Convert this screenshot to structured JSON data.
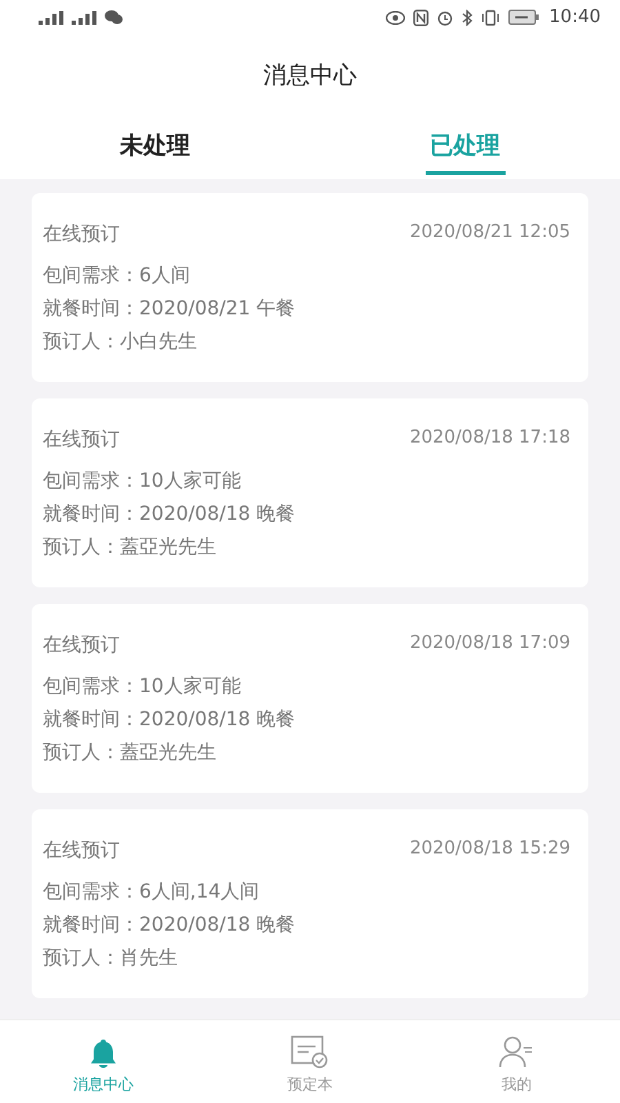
{
  "status_bar": {
    "time": "10:40"
  },
  "header": {
    "title": "消息中心"
  },
  "tabs": [
    {
      "label": "未处理",
      "selected": false
    },
    {
      "label": "已处理",
      "selected": true
    }
  ],
  "messages": [
    {
      "type": "在线预订",
      "time": "2020/08/21 12:05",
      "lines": [
        "包间需求：6人间",
        "就餐时间：2020/08/21 午餐",
        "预订人：小白先生"
      ]
    },
    {
      "type": "在线预订",
      "time": "2020/08/18 17:18",
      "lines": [
        "包间需求：10人家可能",
        "就餐时间：2020/08/18 晚餐",
        "预订人：蓋亞光先生"
      ]
    },
    {
      "type": "在线预订",
      "time": "2020/08/18 17:09",
      "lines": [
        "包间需求：10人家可能",
        "就餐时间：2020/08/18 晚餐",
        "预订人：蓋亞光先生"
      ]
    },
    {
      "type": "在线预订",
      "time": "2020/08/18 15:29",
      "lines": [
        "包间需求：6人间,14人间",
        "就餐时间：2020/08/18 晚餐",
        "预订人：肖先生"
      ]
    }
  ],
  "bottom_nav": [
    {
      "label": "消息中心",
      "kind": "bell",
      "selected": true
    },
    {
      "label": "预定本",
      "kind": "book",
      "selected": false
    },
    {
      "label": "我的",
      "kind": "user",
      "selected": false
    }
  ]
}
